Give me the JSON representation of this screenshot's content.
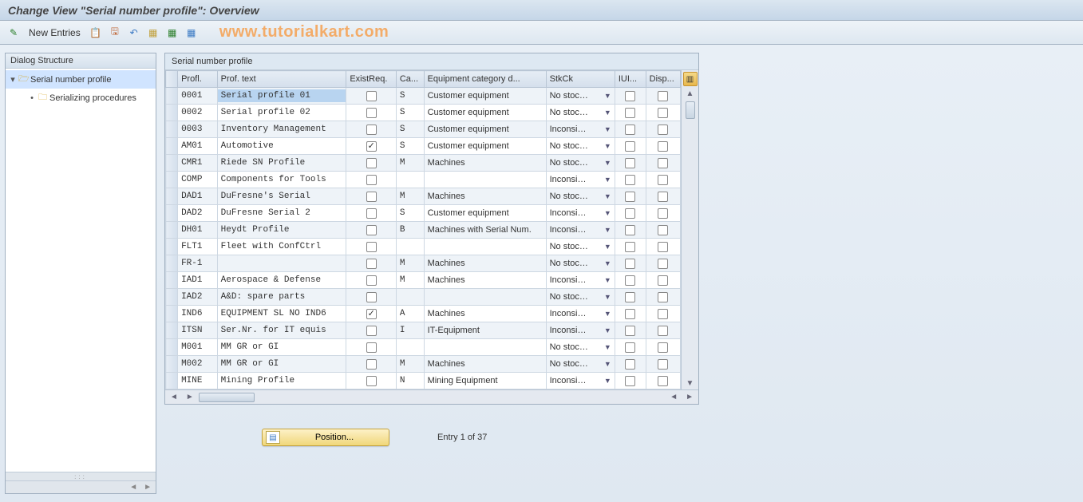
{
  "title": "Change View \"Serial number profile\": Overview",
  "watermark": "www.tutorialkart.com",
  "toolbar": {
    "new_entries": "New Entries"
  },
  "sidebar": {
    "title": "Dialog Structure",
    "node_root": "Serial number profile",
    "node_child": "Serializing procedures"
  },
  "panel": {
    "title": "Serial number profile"
  },
  "columns": {
    "profl": "Profl.",
    "text": "Prof. text",
    "exist": "ExistReq.",
    "cat": "Ca...",
    "catd": "Equipment category d...",
    "stk": "StkCk",
    "iui": "IUI...",
    "disp": "Disp..."
  },
  "rows": [
    {
      "profl": "0001",
      "text": "Serial profile 01",
      "exist": false,
      "cat": "S",
      "catd": "Customer equipment",
      "stk": "No stoc…",
      "iui": false,
      "disp": false,
      "hl": true
    },
    {
      "profl": "0002",
      "text": "Serial profile 02",
      "exist": false,
      "cat": "S",
      "catd": "Customer equipment",
      "stk": "No stoc…",
      "iui": false,
      "disp": false
    },
    {
      "profl": "0003",
      "text": "Inventory Management",
      "exist": false,
      "cat": "S",
      "catd": "Customer equipment",
      "stk": "Inconsi…",
      "iui": false,
      "disp": false
    },
    {
      "profl": "AM01",
      "text": "Automotive",
      "exist": true,
      "cat": "S",
      "catd": "Customer equipment",
      "stk": "No stoc…",
      "iui": false,
      "disp": false
    },
    {
      "profl": "CMR1",
      "text": "Riede SN Profile",
      "exist": false,
      "cat": "M",
      "catd": "Machines",
      "stk": "No stoc…",
      "iui": false,
      "disp": false
    },
    {
      "profl": "COMP",
      "text": "Components for Tools",
      "exist": false,
      "cat": "",
      "catd": "",
      "stk": "Inconsi…",
      "iui": false,
      "disp": false
    },
    {
      "profl": "DAD1",
      "text": "DuFresne's Serial",
      "exist": false,
      "cat": "M",
      "catd": "Machines",
      "stk": "No stoc…",
      "iui": false,
      "disp": false
    },
    {
      "profl": "DAD2",
      "text": "DuFresne Serial 2",
      "exist": false,
      "cat": "S",
      "catd": "Customer equipment",
      "stk": "Inconsi…",
      "iui": false,
      "disp": false
    },
    {
      "profl": "DH01",
      "text": "Heydt Profile",
      "exist": false,
      "cat": "B",
      "catd": "Machines with Serial Num.",
      "stk": "Inconsi…",
      "iui": false,
      "disp": false
    },
    {
      "profl": "FLT1",
      "text": "Fleet with ConfCtrl",
      "exist": false,
      "cat": "",
      "catd": "",
      "stk": "No stoc…",
      "iui": false,
      "disp": false
    },
    {
      "profl": "FR-1",
      "text": "",
      "exist": false,
      "cat": "M",
      "catd": "Machines",
      "stk": "No stoc…",
      "iui": false,
      "disp": false
    },
    {
      "profl": "IAD1",
      "text": "Aerospace & Defense",
      "exist": false,
      "cat": "M",
      "catd": "Machines",
      "stk": "Inconsi…",
      "iui": false,
      "disp": false
    },
    {
      "profl": "IAD2",
      "text": "A&D: spare parts",
      "exist": false,
      "cat": "",
      "catd": "",
      "stk": "No stoc…",
      "iui": false,
      "disp": false
    },
    {
      "profl": "IND6",
      "text": "EQUIPMENT SL NO IND6",
      "exist": true,
      "cat": "A",
      "catd": "Machines",
      "stk": "Inconsi…",
      "iui": false,
      "disp": false
    },
    {
      "profl": "ITSN",
      "text": "Ser.Nr. for IT equis",
      "exist": false,
      "cat": "I",
      "catd": "IT-Equipment",
      "stk": "Inconsi…",
      "iui": false,
      "disp": false
    },
    {
      "profl": "M001",
      "text": "MM GR or GI",
      "exist": false,
      "cat": "",
      "catd": "",
      "stk": "No stoc…",
      "iui": false,
      "disp": false
    },
    {
      "profl": "M002",
      "text": "MM GR or GI",
      "exist": false,
      "cat": "M",
      "catd": "Machines",
      "stk": "No stoc…",
      "iui": false,
      "disp": false
    },
    {
      "profl": "MINE",
      "text": "Mining Profile",
      "exist": false,
      "cat": "N",
      "catd": "Mining Equipment",
      "stk": "Inconsi…",
      "iui": false,
      "disp": false
    }
  ],
  "footer": {
    "position_label": "Position...",
    "entry_text": "Entry 1 of 37"
  }
}
